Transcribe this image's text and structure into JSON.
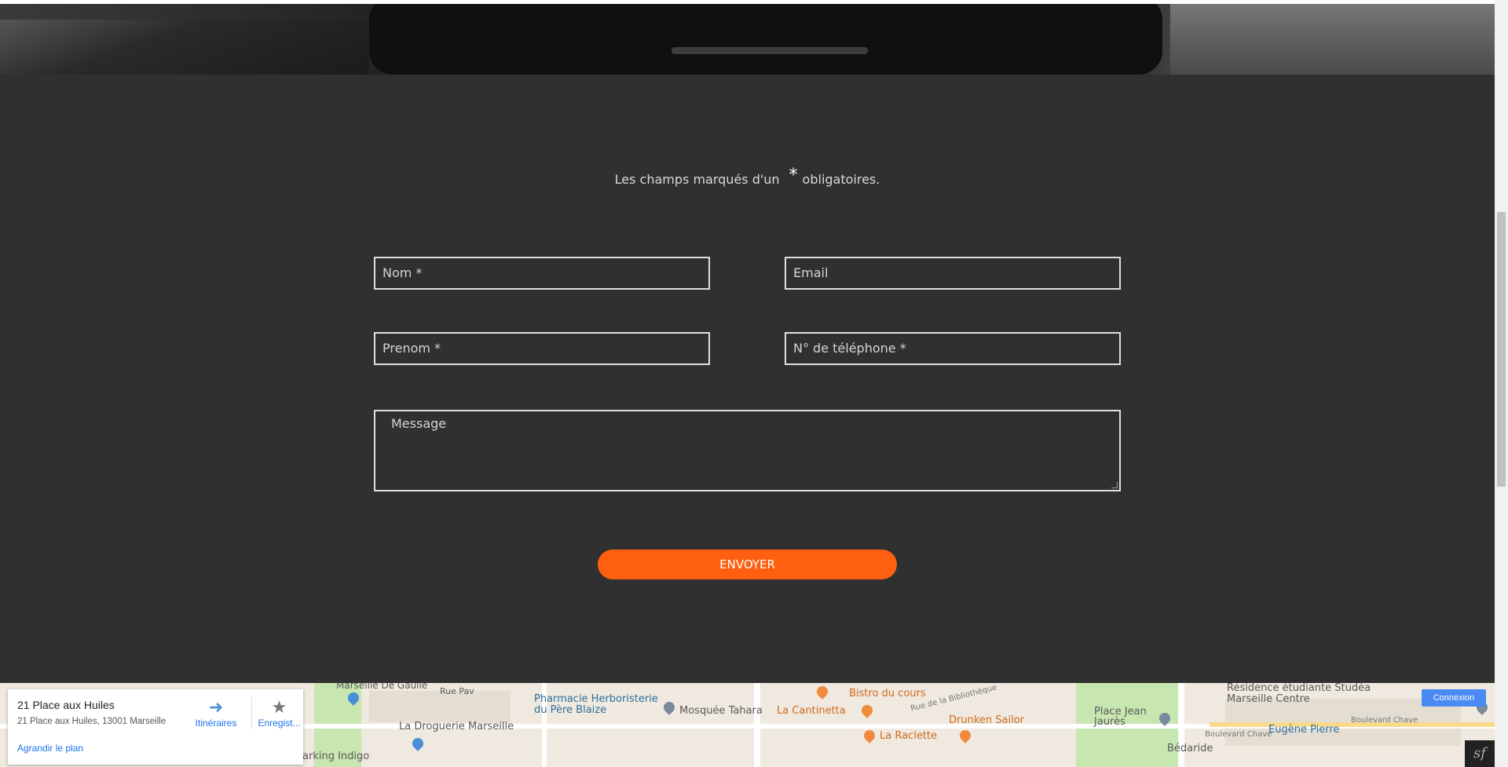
{
  "form": {
    "notice_prefix": "Les champs marqués d'un",
    "notice_star": "*",
    "notice_suffix": "obligatoires.",
    "nom_placeholder": "Nom *",
    "email_placeholder": "Email",
    "prenom_placeholder": "Prenom *",
    "tel_placeholder": "N° de téléphone *",
    "message_placeholder": "Message",
    "submit_label": "ENVOYER"
  },
  "map": {
    "card": {
      "title": "21 Place aux Huiles",
      "address": "21 Place aux Huiles, 13001 Marseille",
      "directions_label": "Itinéraires",
      "save_label": "Enregist...",
      "enlarge_label": "Agrandir le plan"
    },
    "labels": {
      "drugstore": "La Droguerie Marseille",
      "pharmacy": "Pharmacie Herboristerie du Père Blaize",
      "mosque": "Mosquée Tahara",
      "cantinetta": "La Cantinetta",
      "bistro": "Bistro du cours",
      "bibliotheque": "Rue de la Bibliothèque",
      "drunken": "Drunken Sailor",
      "raclette": "La Raclette",
      "place_jean": "Place Jean Jaurès",
      "residence": "Résidence étudiante Studéa Marseille Centre",
      "boulevard_chave": "Boulevard Chave",
      "eugene": "Eugène Pierre",
      "bedaride": "Bédaride",
      "parking": "arking Indigo",
      "degaulle": "Marseille De Gaulle",
      "rue_pav": "Rue Pav",
      "boulevard_chave2": "Boulevard Chave"
    },
    "connexion_label": "Connexion"
  },
  "colors": {
    "accent": "#ff6010",
    "background": "#303030"
  }
}
